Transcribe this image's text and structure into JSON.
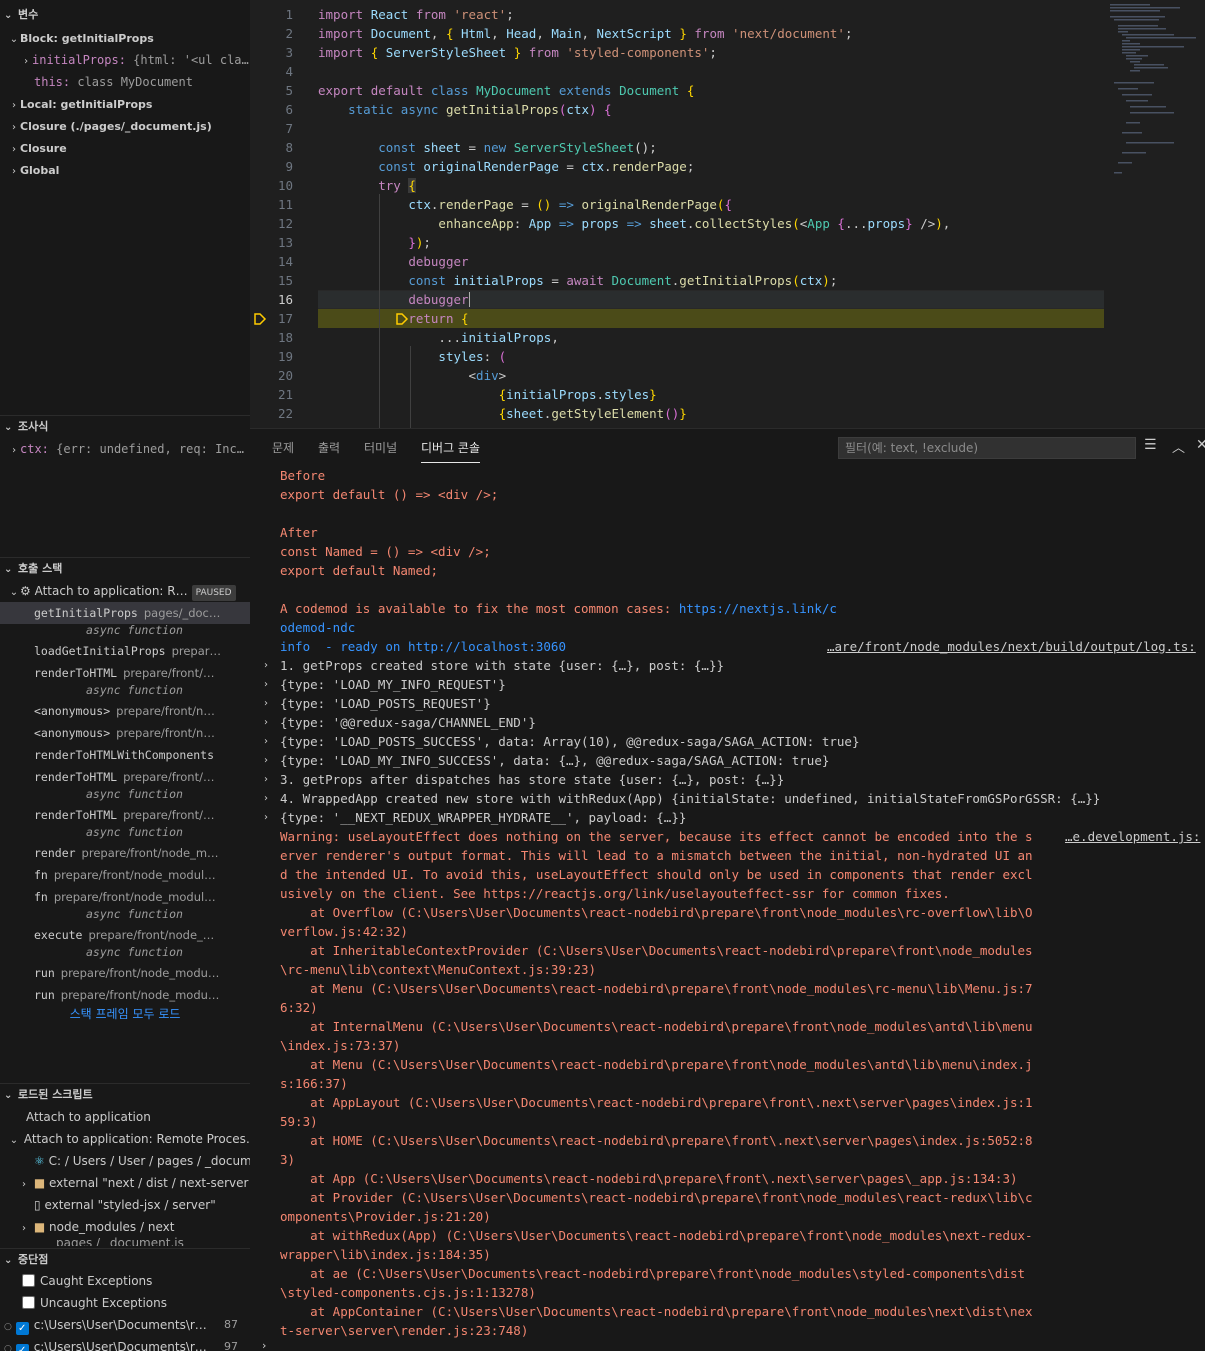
{
  "sidebar": {
    "variables": {
      "header": "변수",
      "block_scope": "Block: getInitialProps",
      "initial_props_name": "initialProps:",
      "initial_props_value": "{html: '<ul cla…",
      "this_name": "this:",
      "this_value": "class MyDocument",
      "scopes": [
        "Local: getInitialProps",
        "Closure (./pages/_document.js)",
        "Closure",
        "Global"
      ]
    },
    "watch": {
      "header": "조사식",
      "item_name": "ctx:",
      "item_value": "{err: undefined, req: Inc…"
    },
    "call_stack": {
      "header": "호출 스택",
      "session": "Attach to application: R…",
      "paused_badge": "PAUSED",
      "frames": [
        {
          "name": "getInitialProps",
          "src": "pages/_doc…",
          "async": "async function"
        },
        {
          "name": "loadGetInitialProps",
          "src": "prepar…",
          "async": ""
        },
        {
          "name": "renderToHTML",
          "src": "prepare/front/…",
          "async": "async function"
        },
        {
          "name": "<anonymous>",
          "src": "prepare/front/n…",
          "async": ""
        },
        {
          "name": "<anonymous>",
          "src": "prepare/front/n…",
          "async": ""
        },
        {
          "name": "renderToHTMLWithComponents",
          "src": "",
          "async": ""
        },
        {
          "name": "renderToHTML",
          "src": "prepare/front/…",
          "async": "async function"
        },
        {
          "name": "renderToHTML",
          "src": "prepare/front/…",
          "async": "async function"
        },
        {
          "name": "render",
          "src": "prepare/front/node_m…",
          "async": ""
        },
        {
          "name": "fn",
          "src": "prepare/front/node_modul…",
          "async": ""
        },
        {
          "name": "fn",
          "src": "prepare/front/node_modul…",
          "async": "async function"
        },
        {
          "name": "execute",
          "src": "prepare/front/node_…",
          "async": "async function"
        },
        {
          "name": "run",
          "src": "prepare/front/node_modu…",
          "async": ""
        },
        {
          "name": "run",
          "src": "prepare/front/node_modu…",
          "async": ""
        }
      ],
      "load_all": "스택 프레임 모두 로드"
    },
    "loaded_scripts": {
      "header": "로드된 스크립트",
      "items": [
        "Attach to application",
        "Attach to application: Remote Proces…",
        "C: / Users / User / pages / _docum…",
        "external \"next / dist / next-server",
        "external \"styled-jsx / server\"",
        "node_modules / next",
        "pages / _document.js"
      ]
    },
    "breakpoints": {
      "header": "중단점",
      "caught": "Caught Exceptions",
      "uncaught": "Uncaught Exceptions",
      "bp1_path": "c:\\Users\\User\\Documents\\r…",
      "bp1_line": "87",
      "bp2_path": "c:\\Users\\User\\Documents\\r…",
      "bp2_line": "97"
    }
  },
  "editor": {
    "line_numbers": [
      "1",
      "2",
      "3",
      "4",
      "5",
      "6",
      "7",
      "8",
      "9",
      "10",
      "11",
      "12",
      "13",
      "14",
      "15",
      "16",
      "17",
      "18",
      "19",
      "20",
      "21",
      "22"
    ],
    "current_line": "16",
    "paused_line": "17"
  },
  "panel": {
    "tabs": [
      "문제",
      "출력",
      "터미널",
      "디버그 콘솔"
    ],
    "active_tab": "디버그 콘솔",
    "filter_placeholder": "필터(예: text, !exclude)",
    "console": [
      "Before",
      "export default () => <div />;",
      "",
      "After",
      "const Named = () => <div />;",
      "export default Named;",
      "",
      "A codemod is available to fix the most common cases: https://nextjs.link/c",
      "odemod-ndc",
      "info  - ready on http://localhost:3060",
      "1. getProps created store with state {user: {…}, post: {…}}",
      "{type: 'LOAD_MY_INFO_REQUEST'}",
      "{type: 'LOAD_POSTS_REQUEST'}",
      "{type: '@@redux-saga/CHANNEL_END'}",
      "{type: 'LOAD_POSTS_SUCCESS', data: Array(10), @@redux-saga/SAGA_ACTION: true}",
      "{type: 'LOAD_MY_INFO_SUCCESS', data: {…}, @@redux-saga/SAGA_ACTION: true}",
      "3. getProps after dispatches has store state {user: {…}, post: {…}}",
      "4. WrappedApp created new store with withRedux(App) {initialState: undefined, initialStateFromGSPorGSSR: {…}}",
      "{type: '__NEXT_REDUX_WRAPPER_HYDRATE__', payload: {…}}",
      "Warning: useLayoutEffect does nothing on the server, because its effect cannot be encoded into the s",
      "erver renderer's output format. This will lead to a mismatch between the initial, non-hydrated UI an",
      "d the intended UI. To avoid this, useLayoutEffect should only be used in components that render excl",
      "usively on the client. See https://reactjs.org/link/uselayouteffect-ssr for common fixes.",
      "    at Overflow (C:\\Users\\User\\Documents\\react-nodebird\\prepare\\front\\node_modules\\rc-overflow\\lib\\O",
      "verflow.js:42:32)",
      "    at InheritableContextProvider (C:\\Users\\User\\Documents\\react-nodebird\\prepare\\front\\node_modules",
      "\\rc-menu\\lib\\context\\MenuContext.js:39:23)",
      "    at Menu (C:\\Users\\User\\Documents\\react-nodebird\\prepare\\front\\node_modules\\rc-menu\\lib\\Menu.js:7",
      "6:32)",
      "    at InternalMenu (C:\\Users\\User\\Documents\\react-nodebird\\prepare\\front\\node_modules\\antd\\lib\\menu",
      "\\index.js:73:37)",
      "    at Menu (C:\\Users\\User\\Documents\\react-nodebird\\prepare\\front\\node_modules\\antd\\lib\\menu\\index.j",
      "s:166:37)",
      "    at AppLayout (C:\\Users\\User\\Documents\\react-nodebird\\prepare\\front\\.next\\server\\pages\\index.js:1",
      "59:3)",
      "    at HOME (C:\\Users\\User\\Documents\\react-nodebird\\prepare\\front\\.next\\server\\pages\\index.js:5052:8",
      "3)",
      "    at App (C:\\Users\\User\\Documents\\react-nodebird\\prepare\\front\\.next\\server\\pages\\_app.js:134:3)",
      "    at Provider (C:\\Users\\User\\Documents\\react-nodebird\\prepare\\front\\node_modules\\react-redux\\lib\\c",
      "omponents\\Provider.js:21:20)",
      "    at withRedux(App) (C:\\Users\\User\\Documents\\react-nodebird\\prepare\\front\\node_modules\\next-redux-",
      "wrapper\\lib\\index.js:184:35)",
      "    at ae (C:\\Users\\User\\Documents\\react-nodebird\\prepare\\front\\node_modules\\styled-components\\dist",
      "\\styled-components.cjs.js:1:13278)",
      "    at AppContainer (C:\\Users\\User\\Documents\\react-nodebird\\prepare\\front\\node_modules\\next\\dist\\nex",
      "t-server\\server\\render.js:23:748)"
    ],
    "source_ready": "…are/front/node_modules/next/build/output/log.ts:",
    "source_warning": "…e.development.js:"
  }
}
